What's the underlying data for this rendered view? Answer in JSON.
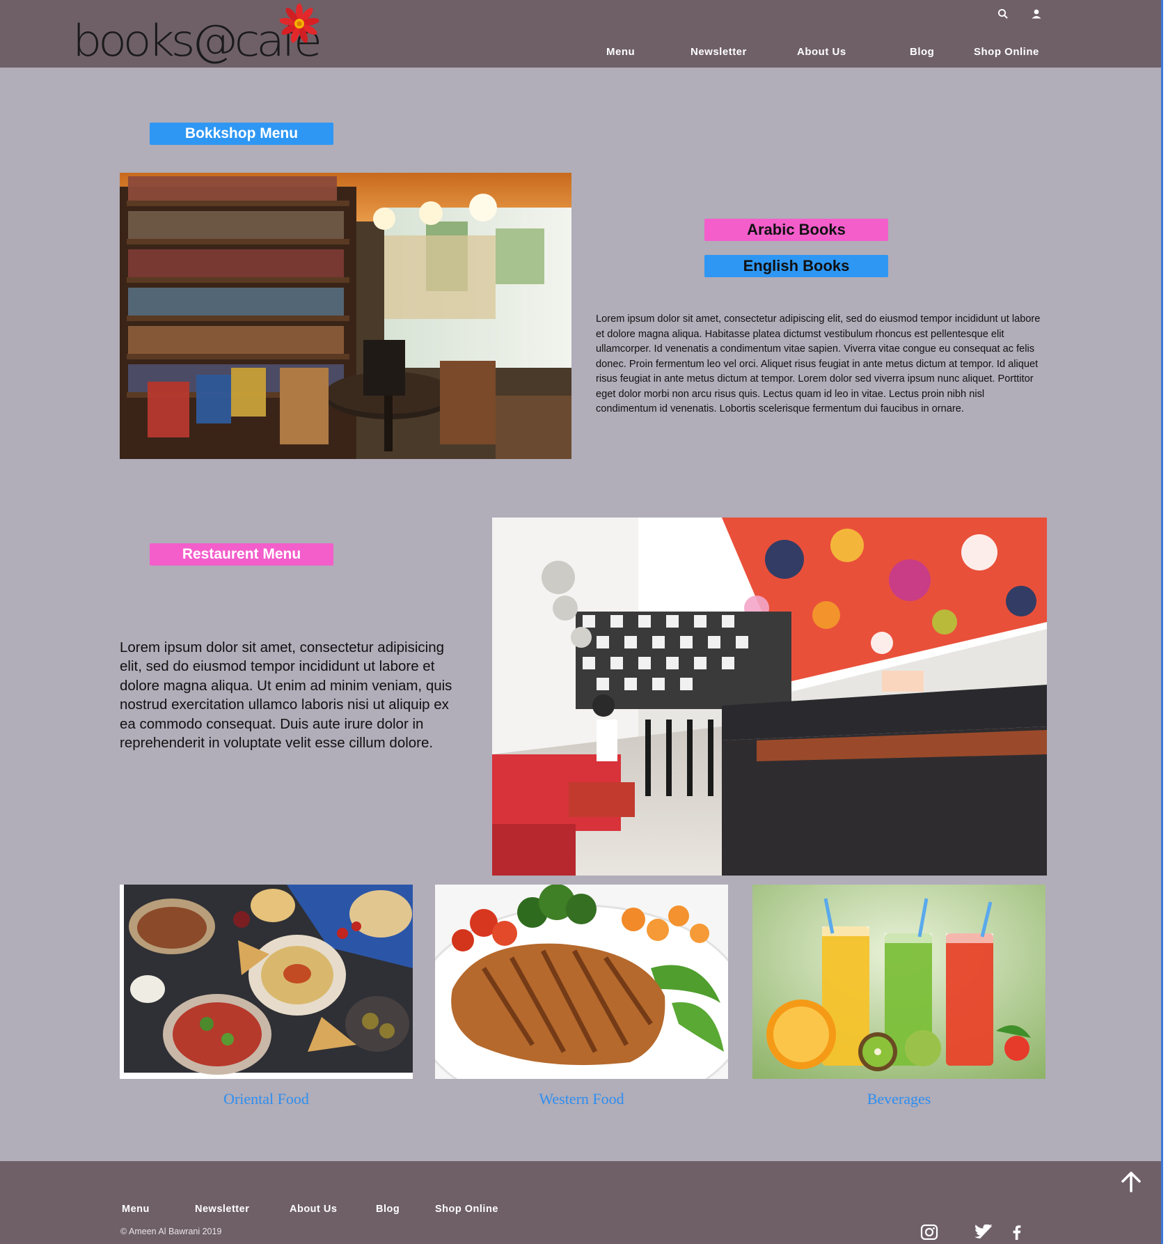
{
  "header": {
    "logo_text": "books@cafe",
    "nav": [
      "Menu",
      "Newsletter",
      "About Us",
      "Blog",
      "Shop Online"
    ],
    "icons": [
      "search-icon",
      "user-icon"
    ]
  },
  "bookshop": {
    "title": "Bokkshop Menu",
    "arabic_button": "Arabic Books",
    "english_button": "English Books",
    "description": "Lorem ipsum dolor sit amet, consectetur adipiscing elit, sed do eiusmod tempor incididunt ut labore et dolore magna aliqua.  Habitasse platea dictumst vestibulum rhoncus est pellentesque elit ullamcorper. Id venenatis a condimentum vitae sapien. Viverra vitae congue eu consequat ac felis donec. Proin fermentum leo vel orci. Aliquet risus feugiat in ante metus dictum at tempor. Id aliquet risus feugiat in ante metus dictum at tempor. Lorem dolor sed viverra ipsum nunc aliquet. Porttitor eget dolor morbi non arcu risus quis. Lectus quam id leo in vitae. Lectus proin nibh nisl condimentum id venenatis. Lobortis scelerisque fermentum dui faucibus in ornare."
  },
  "restaurant": {
    "title": "Restaurent Menu",
    "description": "Lorem ipsum dolor sit amet, consectetur adipisicing elit, sed do eiusmod tempor incididunt ut labore et dolore magna aliqua. Ut enim ad minim veniam, quis nostrud exercitation ullamco laboris nisi ut aliquip ex ea commodo consequat. Duis aute irure dolor in reprehenderit in voluptate velit esse cillum dolore."
  },
  "food": [
    {
      "label": "Oriental Food"
    },
    {
      "label": "Western Food"
    },
    {
      "label": "Beverages"
    }
  ],
  "footer": {
    "nav": [
      "Menu",
      "Newsletter",
      "About Us",
      "Blog",
      "Shop Online"
    ],
    "copyright": "© Ameen Al Bawrani 2019",
    "social": [
      "instagram-icon",
      "twitter-icon",
      "facebook-icon"
    ],
    "back_to_top": "arrow-up-icon"
  },
  "colors": {
    "header_bg": "#6f6068",
    "page_bg": "#b1adb9",
    "accent_blue": "#2e97f4",
    "accent_pink": "#f35ecb",
    "link_blue": "#2d8ef0"
  }
}
